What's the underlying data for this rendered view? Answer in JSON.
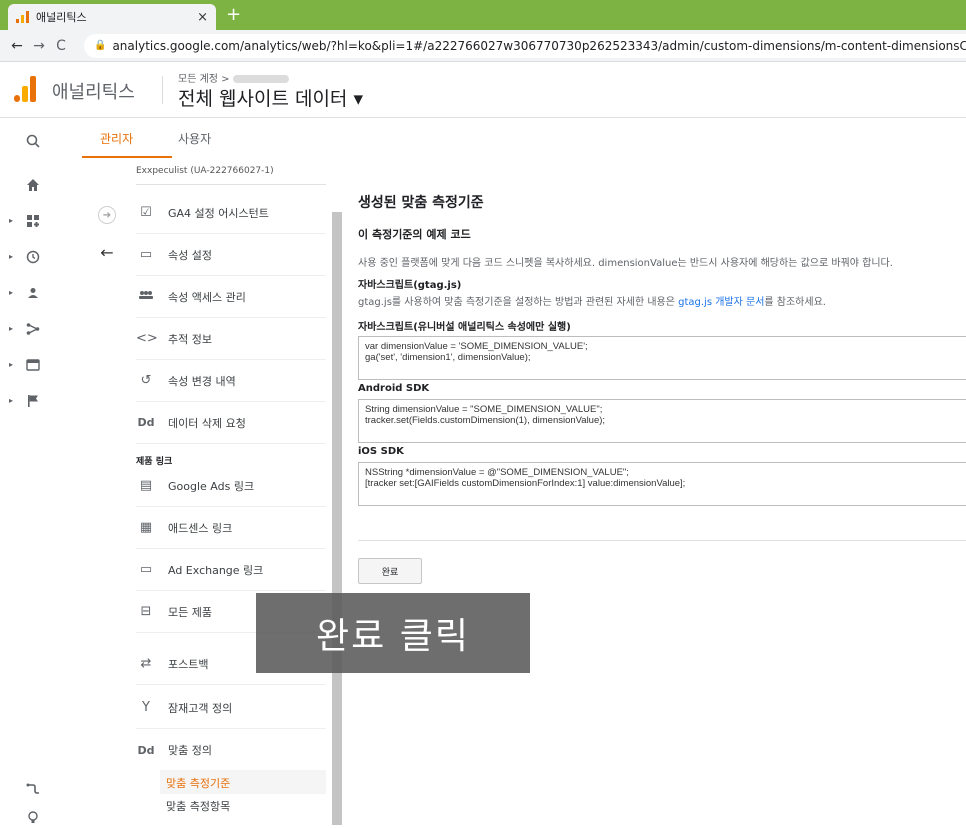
{
  "browser": {
    "tab_title": "애널리틱스",
    "tab_close": "×",
    "new_tab": "+",
    "url": "analytics.google.com/analytics/web/?hl=ko&pli=1#/a222766027w306770730p262523343/admin/custom-dimensions/m-content-dimensionsContent.row"
  },
  "header": {
    "product_name": "애널리틱스",
    "account_label": "모든 계정 >",
    "property_title": "전체 웹사이트 데이터 ▾"
  },
  "tabs": [
    {
      "label": "관리자"
    },
    {
      "label": "사용자"
    }
  ],
  "admin_nav": {
    "cut_off_text": "Exxpeculist (UA-222766027-1)",
    "items": [
      {
        "label": "GA4 설정 어시스턴트",
        "icon": "checkbox-icon"
      },
      {
        "label": "속성 설정",
        "icon": "property-icon"
      },
      {
        "label": "속성 액세스 관리",
        "icon": "people-icon"
      },
      {
        "label": "추적 정보",
        "icon": "code-icon"
      },
      {
        "label": "속성 변경 내역",
        "icon": "history-icon"
      },
      {
        "label": "데이터 삭제 요청",
        "icon": "dd-icon"
      }
    ],
    "section_label": "제품 링크",
    "links": [
      {
        "label": "Google Ads 링크",
        "icon": "ads-icon"
      },
      {
        "label": "애드센스 링크",
        "icon": "adsense-icon"
      },
      {
        "label": "Ad Exchange 링크",
        "icon": "adexchange-icon"
      },
      {
        "label": "모든 제품",
        "icon": "link-icon"
      },
      {
        "label": "포스트백",
        "icon": "postback-icon"
      },
      {
        "label": "잠재고객 정의",
        "icon": "audience-icon"
      },
      {
        "label": "맞춤 정의",
        "icon": "dd-icon"
      }
    ],
    "subitems": [
      {
        "label": "맞춤 측정기준"
      },
      {
        "label": "맞춤 측정항목"
      }
    ]
  },
  "main": {
    "title": "생성된 맞춤 측정기준",
    "subtitle": "이 측정기준의 예제 코드",
    "description": "사용 중인 플랫폼에 맞게 다음 코드 스니펫을 복사하세요. dimensionValue는 반드시 사용자에 해당하는 값으로 바꿔야 합니다.",
    "gtag_title": "자바스크립트(gtag.js)",
    "gtag_desc_prefix": "gtag.js를 사용하여 맞춤 측정기준을 설정하는 방법과 관련된 자세한 내용은 ",
    "gtag_desc_link": "gtag.js 개발자 문서",
    "gtag_desc_suffix": "를 참조하세요.",
    "js_title": "자바스크립트(유니버설 애널리틱스 속성에만 실행)",
    "js_code": "var dimensionValue = 'SOME_DIMENSION_VALUE';\nga('set', 'dimension1', dimensionValue);",
    "android_title": "Android SDK",
    "android_code": "String dimensionValue = \"SOME_DIMENSION_VALUE\";\ntracker.set(Fields.customDimension(1), dimensionValue);",
    "ios_title": "iOS SDK",
    "ios_code": "NSString *dimensionValue = @\"SOME_DIMENSION_VALUE\";\n[tracker set:[GAIFields customDimensionForIndex:1] value:dimensionValue];",
    "done_button": "완료"
  },
  "overlay_caption": "완료 클릭",
  "colors": {
    "tabstrip": "#7cb342",
    "accent_orange": "#e8710a",
    "link_blue": "#1a73e8"
  }
}
